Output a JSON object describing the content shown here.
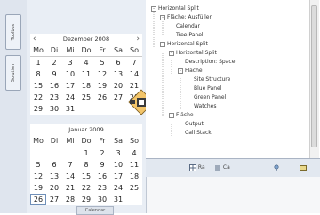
{
  "left_sidebar": {
    "tabs": [
      "Toolbox",
      "Solution"
    ]
  },
  "calendar": {
    "month1": {
      "title": "Dezember 2008",
      "prev_icon": "chevron-left-icon",
      "next_icon": "chevron-right-icon",
      "days_of_week": [
        "Mo",
        "Di",
        "Mi",
        "Do",
        "Fr",
        "Sa",
        "So"
      ],
      "weeks": [
        [
          "1",
          "2",
          "3",
          "4",
          "5",
          "6",
          "7"
        ],
        [
          "8",
          "9",
          "10",
          "11",
          "12",
          "13",
          "14"
        ],
        [
          "15",
          "16",
          "17",
          "18",
          "19",
          "20",
          "21"
        ],
        [
          "22",
          "23",
          "24",
          "25",
          "26",
          "27",
          "28"
        ],
        [
          "29",
          "30",
          "31",
          "",
          "",
          "",
          ""
        ]
      ]
    },
    "month2": {
      "title": "Januar 2009",
      "days_of_week": [
        "Mo",
        "Di",
        "Mi",
        "Do",
        "Fr",
        "Sa",
        "So"
      ],
      "weeks": [
        [
          "",
          "",
          "",
          "1",
          "2",
          "3",
          "4"
        ],
        [
          "5",
          "6",
          "7",
          "8",
          "9",
          "10",
          "11"
        ],
        [
          "12",
          "13",
          "14",
          "15",
          "16",
          "17",
          "18"
        ],
        [
          "19",
          "20",
          "21",
          "22",
          "23",
          "24",
          "25"
        ],
        [
          "26",
          "27",
          "28",
          "29",
          "30",
          "31",
          ""
        ]
      ]
    }
  },
  "tree": {
    "items": [
      {
        "label": "Horizontal Split",
        "level": 0,
        "toggle": "-"
      },
      {
        "label": "Fläche: Ausfüllen",
        "level": 1,
        "toggle": "-"
      },
      {
        "label": "Calendar",
        "level": 2,
        "toggle": ""
      },
      {
        "label": "Tree Panel",
        "level": 2,
        "toggle": ""
      },
      {
        "label": "Horizontal Split",
        "level": 1,
        "toggle": "-"
      },
      {
        "label": "Horizontal Split",
        "level": 2,
        "toggle": "-"
      },
      {
        "label": "Description: Space",
        "level": 3,
        "toggle": ""
      },
      {
        "label": "Fläche",
        "level": 3,
        "toggle": "-"
      },
      {
        "label": "Site Structure",
        "level": 4,
        "toggle": ""
      },
      {
        "label": "Blue Panel",
        "level": 4,
        "toggle": ""
      },
      {
        "label": "Green Panel",
        "level": 4,
        "toggle": ""
      },
      {
        "label": "Watches",
        "level": 4,
        "toggle": ""
      },
      {
        "label": "Fläche",
        "level": 2,
        "toggle": "-"
      },
      {
        "label": "Output",
        "level": 3,
        "toggle": ""
      },
      {
        "label": "Call Stack",
        "level": 3,
        "toggle": ""
      }
    ]
  },
  "toolbar": {
    "buttons": [
      {
        "icon": "grid-icon",
        "label": "Ra"
      },
      {
        "icon": "list-icon",
        "label": "Ca"
      },
      {
        "icon": "pin-icon",
        "label": ""
      },
      {
        "icon": "box-icon",
        "label": ""
      }
    ]
  },
  "bottom_tab": {
    "label": "Calendar"
  }
}
